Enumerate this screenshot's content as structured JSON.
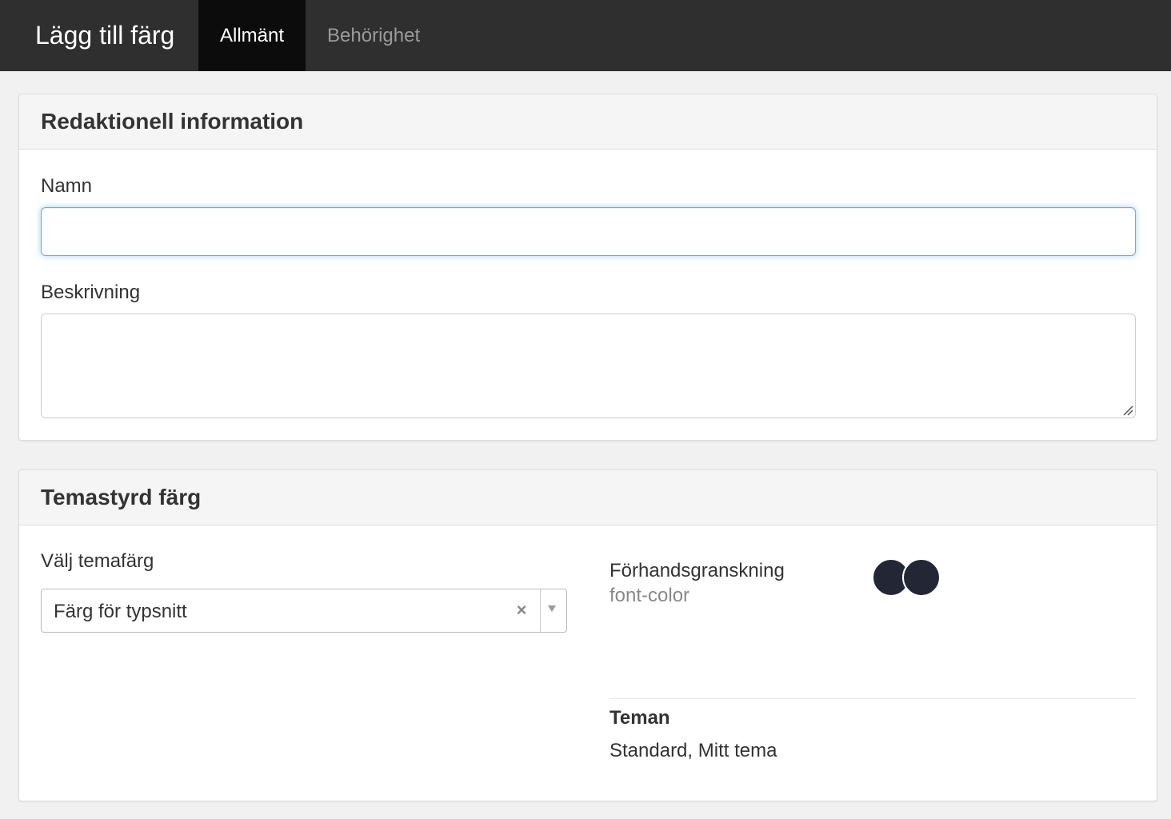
{
  "header": {
    "title": "Lägg till färg",
    "tabs": [
      {
        "label": "Allmänt",
        "active": true
      },
      {
        "label": "Behörighet",
        "active": false
      }
    ]
  },
  "editorial": {
    "heading": "Redaktionell information",
    "name_label": "Namn",
    "name_value": "",
    "description_label": "Beskrivning",
    "description_value": ""
  },
  "theme_color": {
    "heading": "Temastyrd färg",
    "select_label": "Välj temafärg",
    "selected_value": "Färg för typsnitt",
    "preview_label": "Förhandsgranskning",
    "preview_token": "font-color",
    "swatch_colors": [
      "#232634",
      "#232634"
    ],
    "themes_label": "Teman",
    "themes_value": "Standard, Mitt tema"
  },
  "colors": {
    "topbar": "#2f2f2f",
    "active_tab": "#0c0c0c",
    "focus_border": "#66afe9"
  }
}
